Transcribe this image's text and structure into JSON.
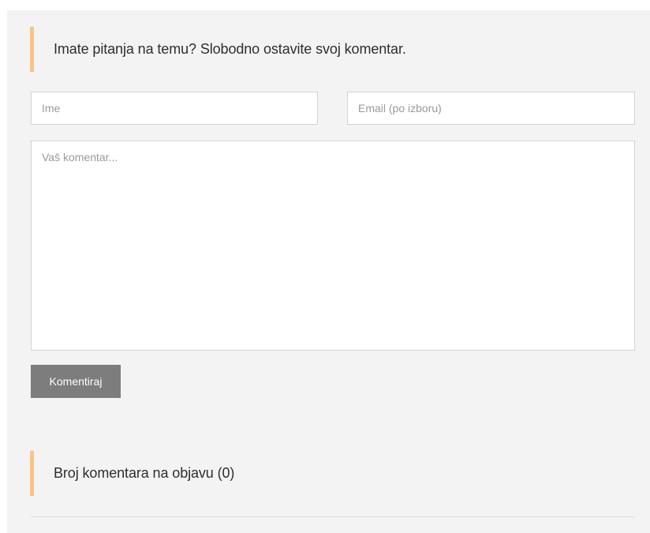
{
  "comment_form": {
    "heading": "Imate pitanja na temu? Slobodno ostavite svoj komentar.",
    "name_placeholder": "Ime",
    "email_placeholder": "Email (po izboru)",
    "comment_placeholder": "Vaš komentar...",
    "submit_label": "Komentiraj"
  },
  "comments_section": {
    "heading": "Broj komentara na objavu (0)"
  },
  "colors": {
    "panel_background": "#f3f3f3",
    "heading_accent": "#fdc383",
    "button_background": "#7d7d7d",
    "input_border": "#d3d3d3"
  }
}
